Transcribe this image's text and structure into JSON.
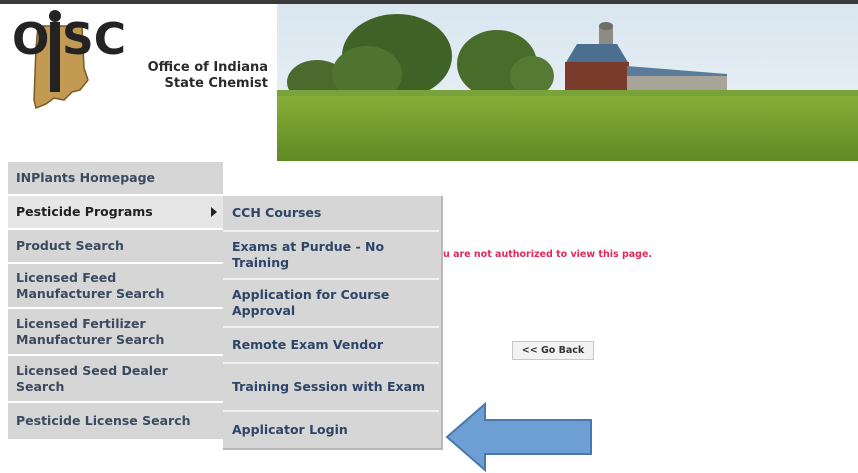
{
  "logo": {
    "acronym": "OISC",
    "line1": "Office of Indiana",
    "line2": "State Chemist"
  },
  "banner": {
    "icon": "farm-landscape-image"
  },
  "left_menu": {
    "items": [
      {
        "label": "INPlants Homepage"
      },
      {
        "label": "Pesticide Programs",
        "active": true
      },
      {
        "label": "Product Search"
      },
      {
        "label": "Licensed Feed Manufacturer Search"
      },
      {
        "label": "Licensed Fertilizer Manufacturer Search"
      },
      {
        "label": "Licensed Seed Dealer Search"
      },
      {
        "label": "Pesticide License Search"
      }
    ]
  },
  "submenu": {
    "items": [
      {
        "label": "CCH Courses"
      },
      {
        "label": "Exams at Purdue - No Training"
      },
      {
        "label": "Application for Course Approval"
      },
      {
        "label": "Remote Exam Vendor"
      },
      {
        "label": "Training Session with Exam"
      },
      {
        "label": "Applicator Login"
      }
    ]
  },
  "main": {
    "error_text": "u are not authorized to view this page.",
    "go_back_label": "<< Go Back"
  },
  "annotation": {
    "icon": "blue-arrow-left",
    "color": "#6d9fd4"
  },
  "colors": {
    "menu_bg": "#d6d6d6",
    "menu_text": "#3a4a60",
    "error": "#e0295a"
  }
}
